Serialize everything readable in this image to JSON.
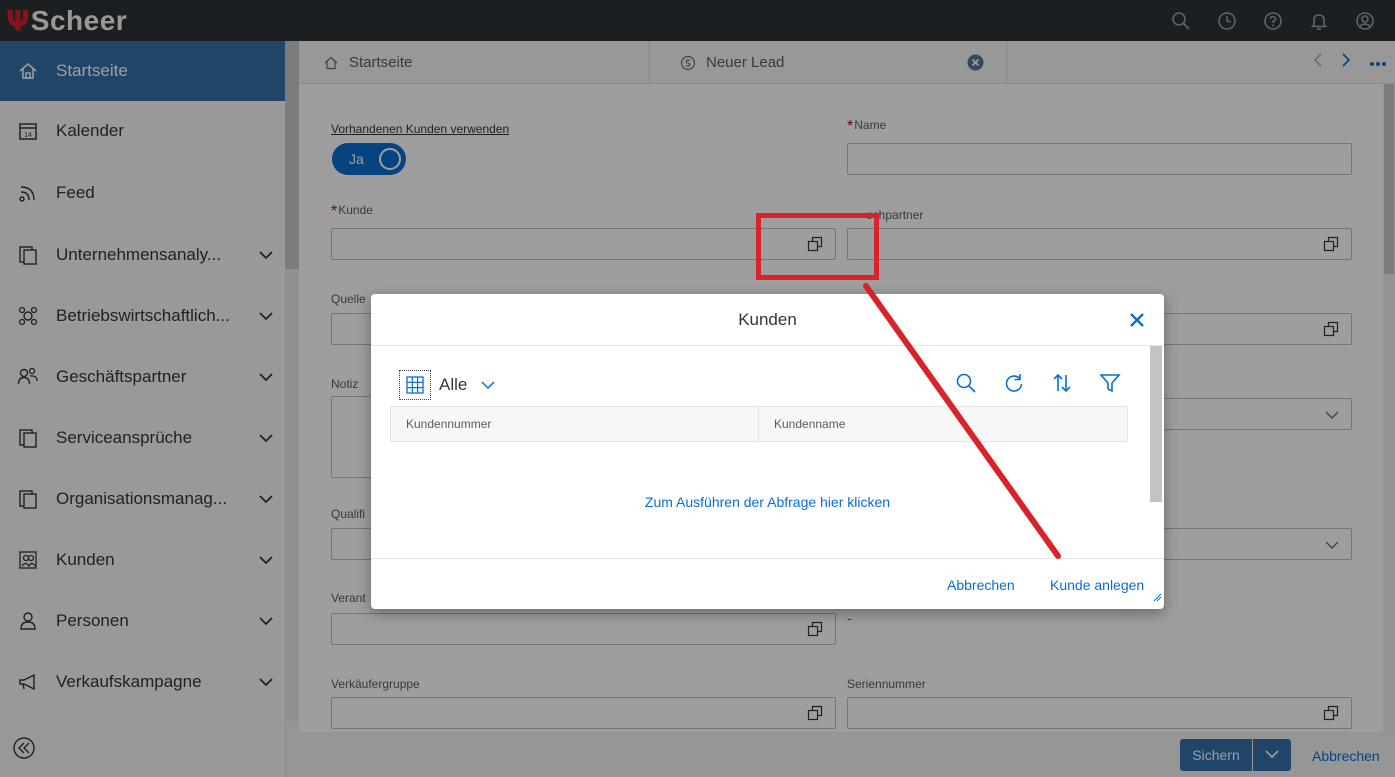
{
  "shell": {
    "logo_text": "Scheer",
    "icons": [
      "search-icon",
      "history-icon",
      "help-icon",
      "notifications-icon",
      "user-icon"
    ]
  },
  "sidebar": {
    "items": [
      {
        "label": "Startseite",
        "icon": "home-icon",
        "active": true,
        "has_chevron": false
      },
      {
        "label": "Kalender",
        "icon": "calendar-icon",
        "has_chevron": false
      },
      {
        "label": "Feed",
        "icon": "feed-icon",
        "has_chevron": false
      },
      {
        "label": "Unternehmensanaly...",
        "icon": "copy-icon",
        "has_chevron": true
      },
      {
        "label": "Betriebswirtschaftlich...",
        "icon": "group-icon",
        "has_chevron": true
      },
      {
        "label": "Geschäftspartner",
        "icon": "partner-icon",
        "has_chevron": true
      },
      {
        "label": "Serviceansprüche",
        "icon": "copy-icon",
        "has_chevron": true
      },
      {
        "label": "Organisationsmanag...",
        "icon": "copy-icon",
        "has_chevron": true
      },
      {
        "label": "Kunden",
        "icon": "customers-icon",
        "has_chevron": true
      },
      {
        "label": "Personen",
        "icon": "person-icon",
        "has_chevron": true
      },
      {
        "label": "Verkaufskampagne",
        "icon": "megaphone-icon",
        "has_chevron": true
      }
    ]
  },
  "tabs": [
    {
      "label": "Startseite",
      "icon": "home-icon"
    },
    {
      "label": "Neuer Lead",
      "icon": "lead-icon",
      "closable": true
    }
  ],
  "form": {
    "use_existing_label": "Vorhandenen Kunden verwenden",
    "toggle_value": "Ja",
    "name_label": "Name",
    "customer_label": "Kunde",
    "contact_label": "echpartner",
    "source_label": "Quelle",
    "note_label": "Notiz",
    "qualification_label": "Qualifi",
    "responsible_label": "Verant",
    "sales_group_label": "Verkäufergruppe",
    "serial_label": "Seriennummer",
    "dash": "-"
  },
  "dialog": {
    "title": "Kunden",
    "view": "Alle",
    "columns": [
      "Kundennummer",
      "Kundenname"
    ],
    "run_query": "Zum Ausführen der Abfrage hier klicken",
    "cancel": "Abbrechen",
    "create": "Kunde anlegen"
  },
  "footer": {
    "save": "Sichern",
    "cancel": "Abbrechen"
  },
  "colors": {
    "accent": "#0a6ed1",
    "shell": "#2e3338",
    "active_nav": "#3470a8",
    "annotation": "#d9222a",
    "required": "#bb0000"
  }
}
